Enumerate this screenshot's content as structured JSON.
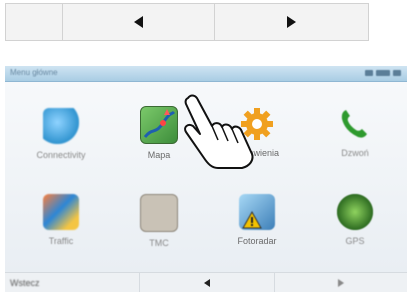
{
  "top_nav": {
    "prev_icon": "triangle-left",
    "next_icon": "triangle-right"
  },
  "device": {
    "statusbar_title": "Menu główne",
    "tiles": [
      {
        "label": "Connectivity",
        "icon": "connect-icon"
      },
      {
        "label": "Mapa",
        "icon": "map-icon"
      },
      {
        "label": "Ustawienia",
        "icon": "gear-icon"
      },
      {
        "label": "Dzwoń",
        "icon": "phone-icon"
      },
      {
        "label": "Traffic",
        "icon": "traffic-icon"
      },
      {
        "label": "TMC",
        "icon": "tmc-icon"
      },
      {
        "label": "Fotoradar",
        "icon": "camera-warning-icon"
      },
      {
        "label": "GPS",
        "icon": "gps-icon"
      }
    ],
    "bottom_label": "Wstecz",
    "bottom_prev_icon": "triangle-left",
    "bottom_next_icon": "triangle-right"
  },
  "colors": {
    "accent_green": "#2e9a2e",
    "accent_orange": "#f0a020",
    "statusbar": "#a9cde4"
  }
}
